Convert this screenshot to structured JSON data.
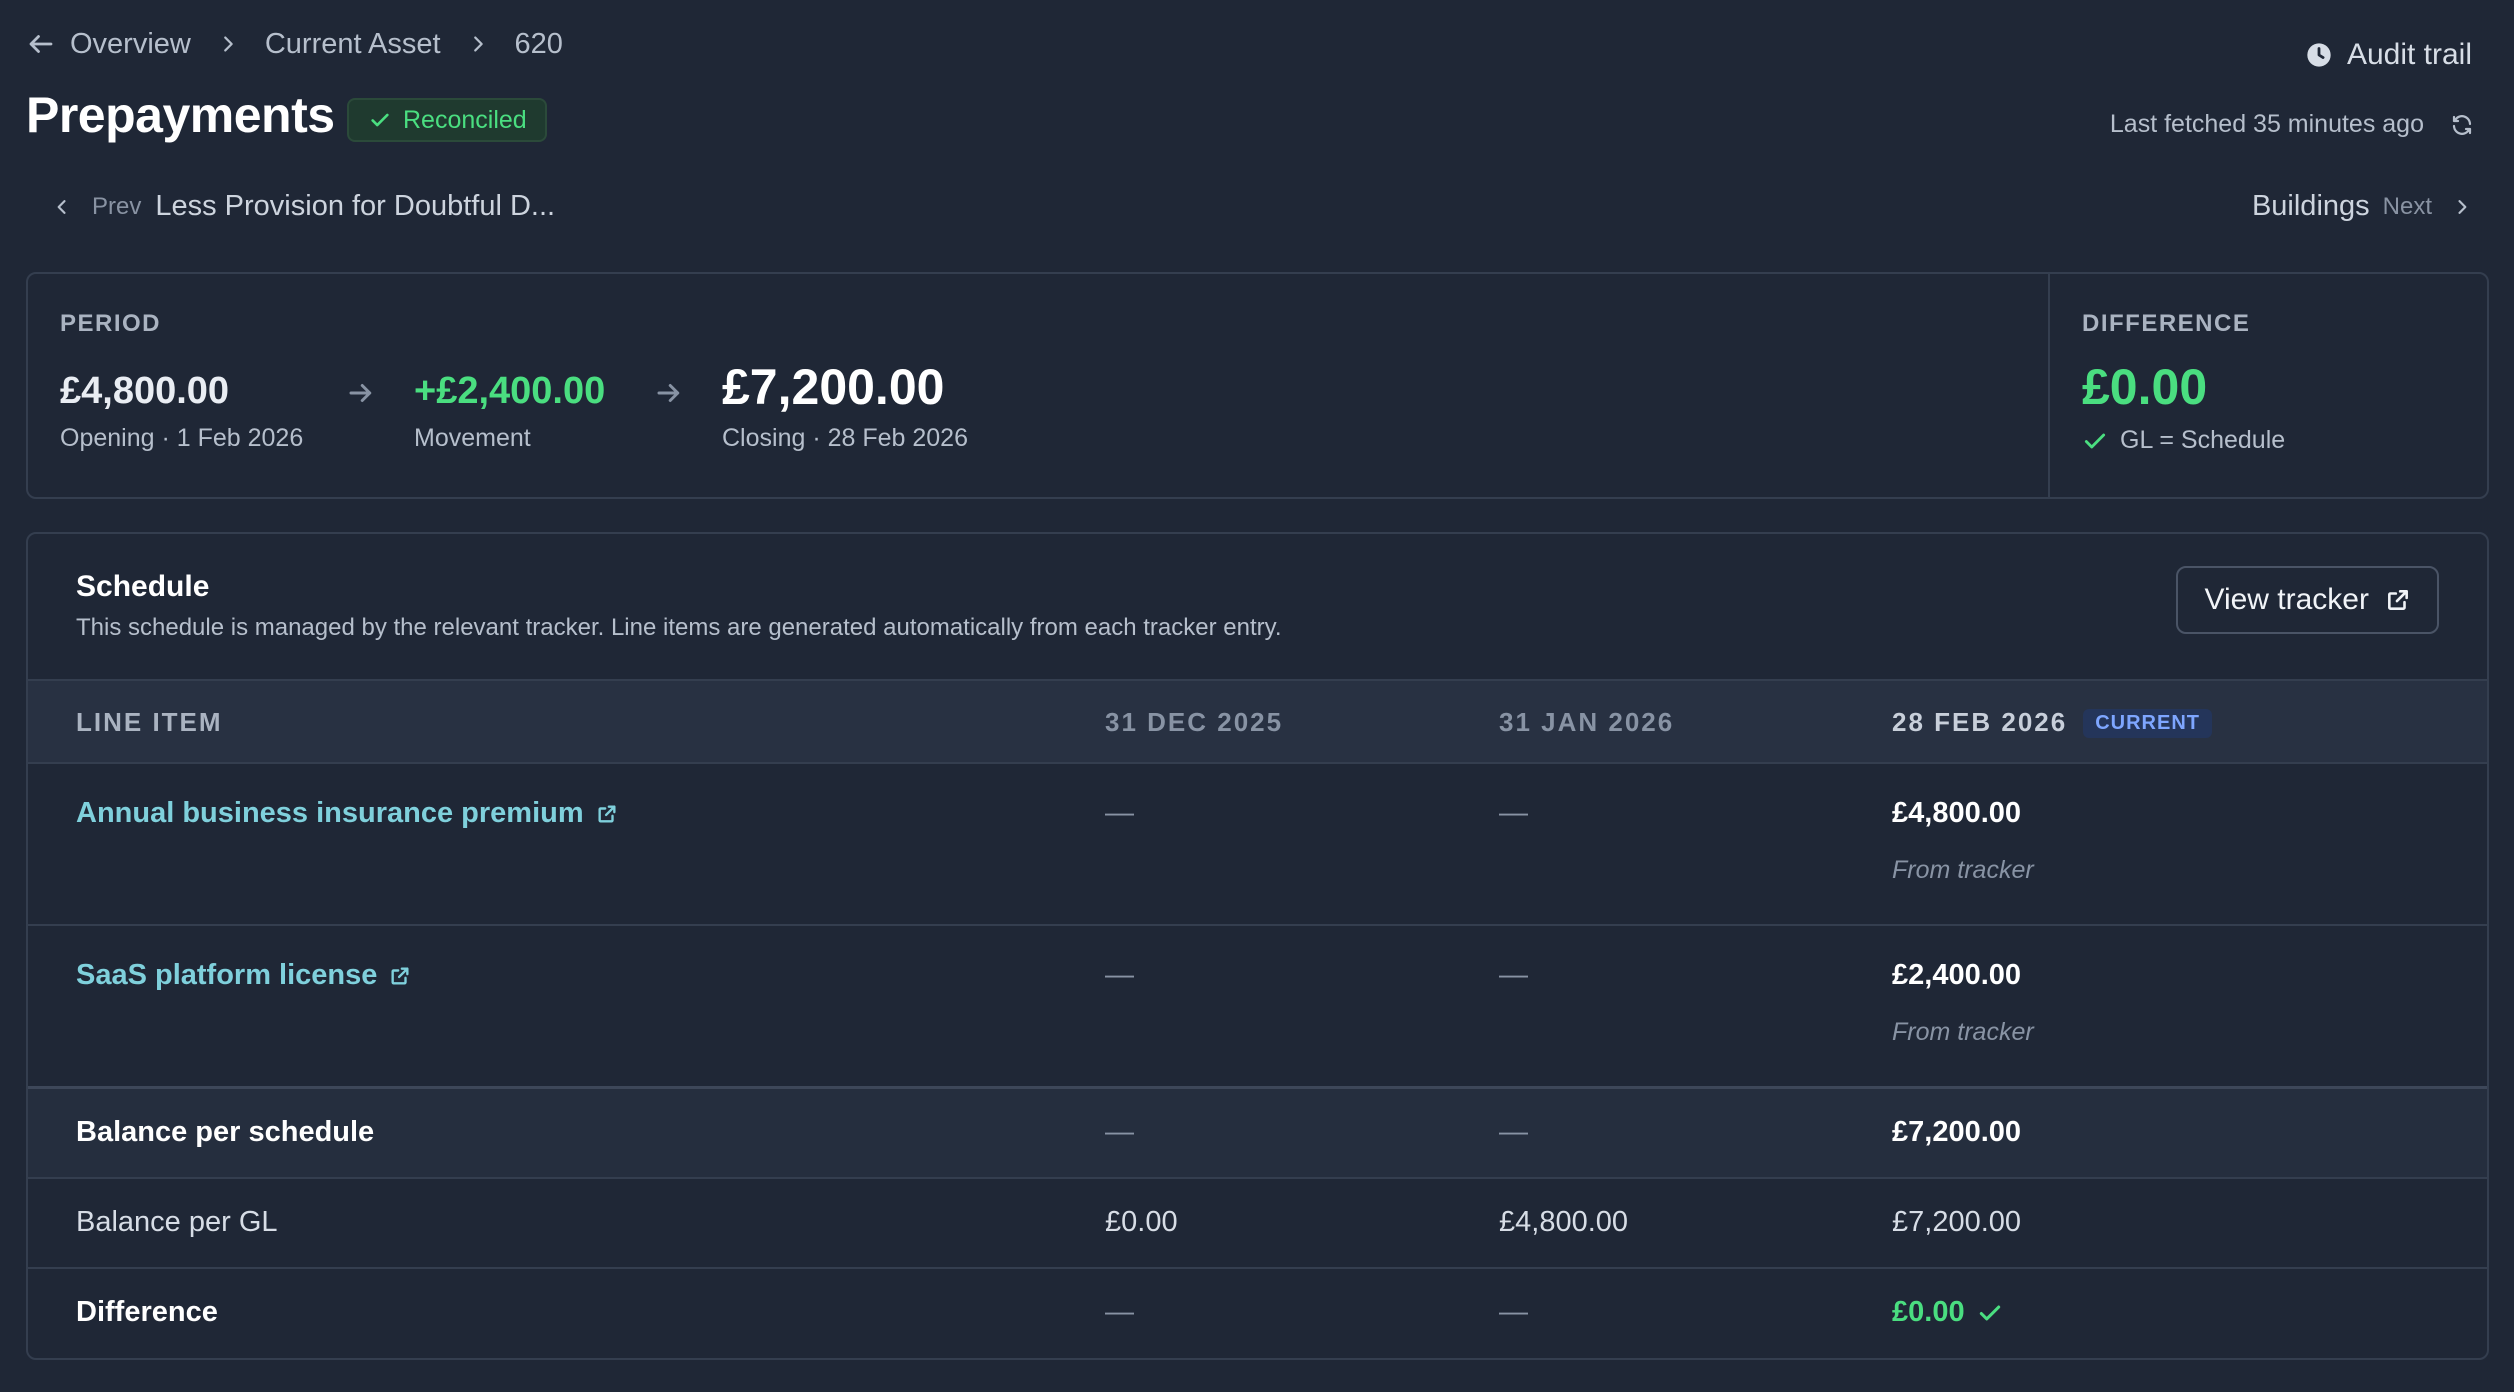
{
  "breadcrumb": {
    "items": [
      "Overview",
      "Current Asset",
      "620"
    ]
  },
  "page": {
    "title": "Prepayments",
    "status": "Reconciled"
  },
  "header": {
    "audit_trail": "Audit trail",
    "last_fetched": "Last fetched 35 minutes ago"
  },
  "nav": {
    "prev_label": "Prev",
    "prev_name": "Less Provision for Doubtful D...",
    "next_label": "Next",
    "next_name": "Buildings"
  },
  "period": {
    "caption": "PERIOD",
    "opening_amount": "£4,800.00",
    "opening_label": "Opening · 1 Feb 2026",
    "movement_amount": "+£2,400.00",
    "movement_label": "Movement",
    "closing_amount": "£7,200.00",
    "closing_label": "Closing · 28 Feb 2026"
  },
  "difference": {
    "caption": "DIFFERENCE",
    "amount": "£0.00",
    "note": "GL = Schedule"
  },
  "schedule": {
    "title": "Schedule",
    "description": "This schedule is managed by the relevant tracker. Line items are generated automatically from each tracker entry.",
    "view_tracker": "View tracker",
    "columns": [
      "LINE ITEM",
      "31 DEC 2025",
      "31 JAN 2026",
      "28 FEB 2026"
    ],
    "current_badge": "CURRENT",
    "line_items": [
      {
        "name": "Annual business insurance premium",
        "dec": "—",
        "jan": "—",
        "feb": "£4,800.00",
        "source": "From tracker"
      },
      {
        "name": "SaaS platform license",
        "dec": "—",
        "jan": "—",
        "feb": "£2,400.00",
        "source": "From tracker"
      }
    ],
    "balance_schedule": {
      "label": "Balance per schedule",
      "dec": "—",
      "jan": "—",
      "feb": "£7,200.00"
    },
    "balance_gl": {
      "label": "Balance per GL",
      "dec": "£0.00",
      "jan": "£4,800.00",
      "feb": "£7,200.00"
    },
    "difference_row": {
      "label": "Difference",
      "dec": "—",
      "jan": "—",
      "feb": "£0.00"
    }
  },
  "colors": {
    "background": "#1f2736",
    "accent_green": "#4ade80",
    "link": "#7fd0dc",
    "current_badge": "#7ea6ff"
  }
}
